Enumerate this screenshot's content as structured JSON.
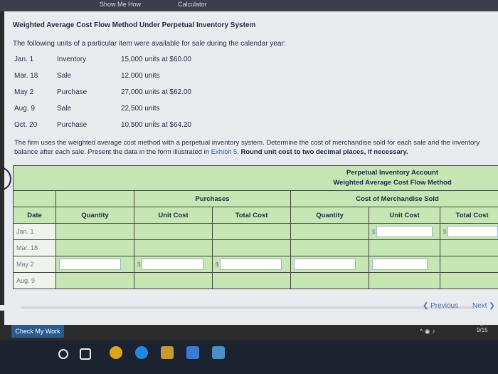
{
  "topbar": {
    "show_me_how": "Show Me How",
    "calculator": "Calculator"
  },
  "title": "Weighted Average Cost Flow Method Under Perpetual Inventory System",
  "intro": "The following units of a particular item were available for sale during the calendar year:",
  "inventory_rows": [
    {
      "date": "Jan. 1",
      "type": "Inventory",
      "detail": "15,000 units at $60.00"
    },
    {
      "date": "Mar. 18",
      "type": "Sale",
      "detail": "12,000 units"
    },
    {
      "date": "May 2",
      "type": "Purchase",
      "detail": "27,000 units at $62.00"
    },
    {
      "date": "Aug. 9",
      "type": "Sale",
      "detail": "22,500 units"
    },
    {
      "date": "Oct. 20",
      "type": "Purchase",
      "detail": "10,500 units at $64.20"
    }
  ],
  "paragraph": {
    "part1": "The firm uses the weighted average cost method with a perpetual inventory system. Determine the cost of merchandise sold for each sale and the inventory balance after each sale. Present the data in the form illustrated in ",
    "link": "Exhibit 5",
    "part2": ". ",
    "bold": "Round unit cost to two decimal places, if necessary."
  },
  "ledger": {
    "title1": "Perpetual Inventory Account",
    "title2": "Weighted Average Cost Flow Method",
    "purchases": "Purchases",
    "cogs": "Cost of Merchandise Sold",
    "date": "Date",
    "quantity": "Quantity",
    "unit_cost": "Unit Cost",
    "total_cost": "Total Cost",
    "dollar": "$",
    "rows": [
      "Jan. 1",
      "Mar. 18",
      "May 2",
      "Aug. 9"
    ]
  },
  "nav": {
    "previous": "Previous",
    "next": "Next"
  },
  "check_button": "Check My Work",
  "clock": {
    "time": "5:4",
    "date": "9/15"
  }
}
